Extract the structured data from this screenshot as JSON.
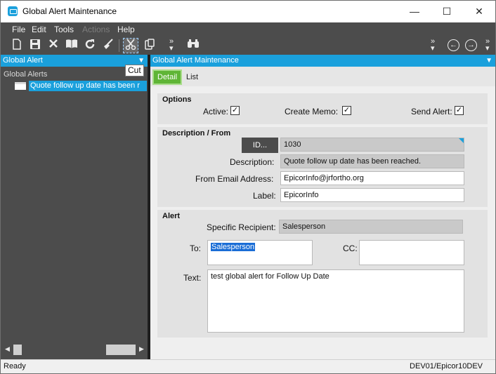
{
  "window": {
    "title": "Global Alert Maintenance",
    "minimize": "—",
    "maximize": "☐",
    "close": "✕"
  },
  "menu": {
    "file": "File",
    "edit": "Edit",
    "tools": "Tools",
    "actions": "Actions",
    "help": "Help"
  },
  "toolbar": {
    "icons": [
      "new-icon",
      "save-icon",
      "delete-icon",
      "open-book-icon",
      "refresh-icon",
      "clear-icon",
      "cut-icon",
      "paste-icon",
      "search-binoculars-icon",
      "back-icon",
      "forward-icon"
    ],
    "overflow": "»",
    "tooltip": "Cut"
  },
  "left_panel": {
    "header": "Global Alert",
    "pin": "📌",
    "tree_root": "Global Alerts",
    "tree_item": "Quote follow up date has been r"
  },
  "right_panel": {
    "header": "Global Alert Maintenance",
    "tabs": [
      {
        "label": "Detail"
      },
      {
        "label": "List"
      }
    ]
  },
  "options": {
    "title": "Options",
    "active_label": "Active:",
    "active_checked": true,
    "create_memo_label": "Create Memo:",
    "create_memo_checked": true,
    "send_alert_label": "Send Alert:",
    "send_alert_checked": true
  },
  "description": {
    "title": "Description / From",
    "id_button": "ID...",
    "id_value": "1030",
    "description_label": "Description:",
    "description_value": "Quote follow up date has been reached.",
    "email_label": "From Email Address:",
    "email_value": "EpicorInfo@jrfortho.org",
    "label_label": "Label:",
    "label_value": "EpicorInfo"
  },
  "alert": {
    "title": "Alert",
    "specific_recipient_label": "Specific Recipient:",
    "specific_recipient_value": "Salesperson",
    "to_label": "To:",
    "to_value": "Salesperson",
    "cc_label": "CC:",
    "cc_value": "",
    "text_label": "Text:",
    "text_value": "test global alert for Follow Up Date"
  },
  "status": {
    "left": "Ready",
    "right": "DEV01/Epicor10DEV"
  },
  "colors": {
    "accent": "#1aa0dc",
    "dark": "#4c4c4c",
    "tab_active": "#5fb536"
  }
}
